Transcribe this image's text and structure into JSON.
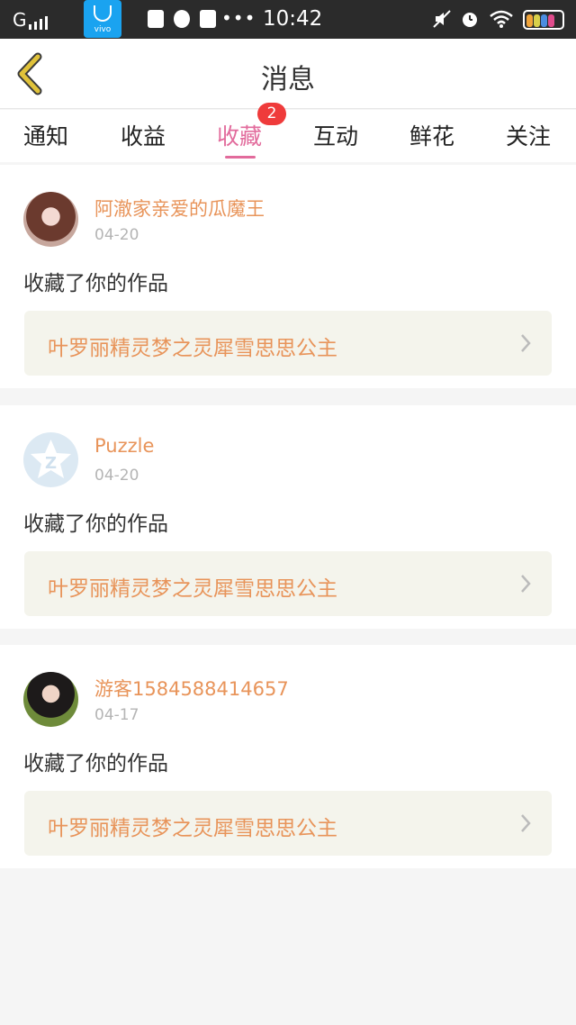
{
  "status_bar": {
    "carrier": "G",
    "app_label": "vivo",
    "time": "10:42",
    "more": "•••"
  },
  "header": {
    "title": "消息"
  },
  "tabs": [
    {
      "label": "通知"
    },
    {
      "label": "收益"
    },
    {
      "label": "收藏",
      "active": true,
      "badge": "2"
    },
    {
      "label": "互动"
    },
    {
      "label": "鲜花"
    },
    {
      "label": "关注"
    }
  ],
  "notifications": [
    {
      "user": "阿澈家亲爱的瓜魔王",
      "date": "04-20",
      "action": "收藏了你的作品",
      "work": "叶罗丽精灵梦之灵犀雪思思公主"
    },
    {
      "user": "Puzzle",
      "date": "04-20",
      "action": "收藏了你的作品",
      "work": "叶罗丽精灵梦之灵犀雪思思公主"
    },
    {
      "user": "游客1584588414657",
      "date": "04-17",
      "action": "收藏了你的作品",
      "work": "叶罗丽精灵梦之灵犀雪思思公主"
    }
  ],
  "colors": {
    "accent": "#e26b9c",
    "username": "#e8945a",
    "badge": "#ef3b3b",
    "back_arrow": "#e0c23a"
  }
}
